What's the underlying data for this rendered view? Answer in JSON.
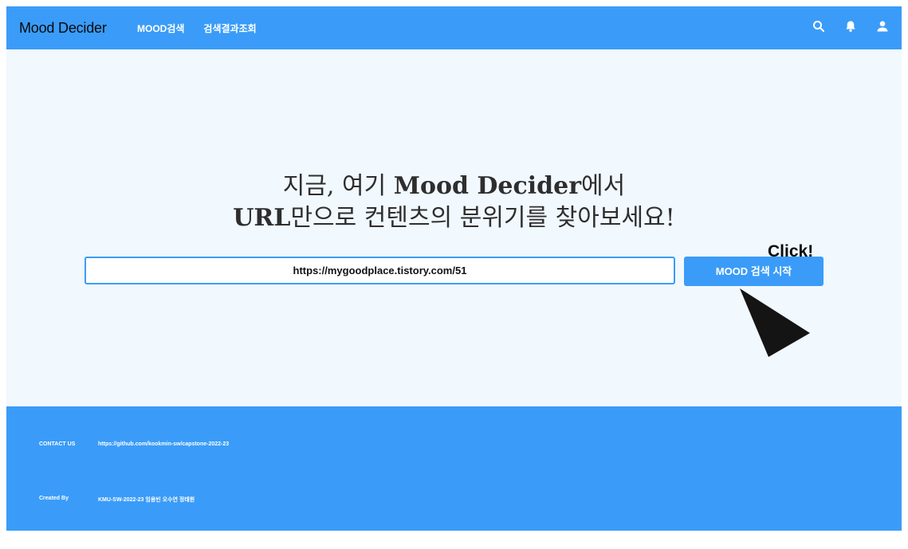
{
  "navbar": {
    "logo": "Mood Decider",
    "links": [
      "MOOD검색",
      "검색결과조회"
    ],
    "icons": [
      "search-icon",
      "bell-icon",
      "user-icon"
    ]
  },
  "hero": {
    "line1_prefix": "지금, 여기 ",
    "line1_brand": "Mood Decider",
    "line1_suffix": "에서",
    "line2_brand": "URL",
    "line2_suffix": "만으로 컨텐츠의 분위기를 찾아보세요!"
  },
  "search": {
    "value": "https://mygoodplace.tistory.com/51",
    "button_label": "MOOD 검색 시작"
  },
  "annotation": {
    "label": "Click!"
  },
  "footer": {
    "contact_label": "CONTACT US",
    "contact_value": "https://github.com/kookmin-sw/capstone-2022-23",
    "created_label": "Created By",
    "created_value": "KMU-SW-2022-23 임용빈 오수연 정태원"
  },
  "colors": {
    "primary": "#3a9cf8",
    "background": "#f1f8fe"
  }
}
